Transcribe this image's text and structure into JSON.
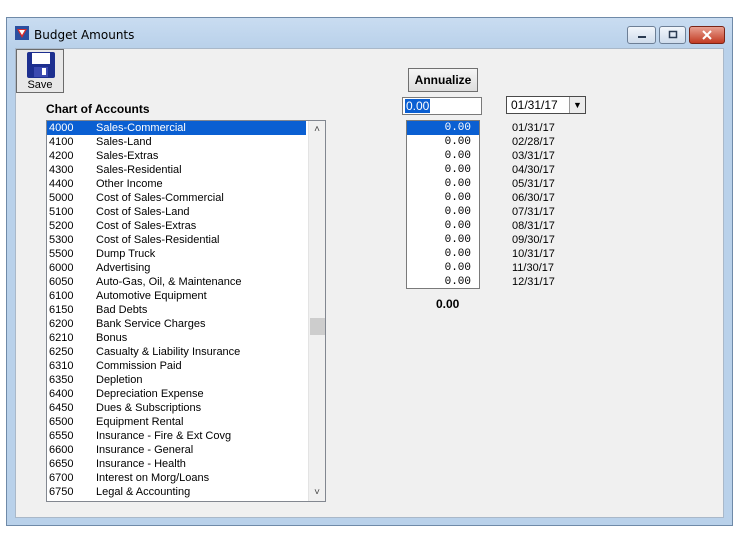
{
  "window": {
    "title": "Budget Amounts",
    "controls": [
      "minimize",
      "maximize",
      "close"
    ]
  },
  "toolbar": {
    "save_label": "Save"
  },
  "chart_of_accounts": {
    "label": "Chart of Accounts",
    "selected_index": 0,
    "items": [
      {
        "code": "4000",
        "name": "Sales-Commercial"
      },
      {
        "code": "4100",
        "name": "Sales-Land"
      },
      {
        "code": "4200",
        "name": "Sales-Extras"
      },
      {
        "code": "4300",
        "name": "Sales-Residential"
      },
      {
        "code": "4400",
        "name": "Other Income"
      },
      {
        "code": "5000",
        "name": "Cost of Sales-Commercial"
      },
      {
        "code": "5100",
        "name": "Cost of Sales-Land"
      },
      {
        "code": "5200",
        "name": "Cost of Sales-Extras"
      },
      {
        "code": "5300",
        "name": "Cost of Sales-Residential"
      },
      {
        "code": "5500",
        "name": "Dump Truck"
      },
      {
        "code": "6000",
        "name": "Advertising"
      },
      {
        "code": "6050",
        "name": "Auto-Gas, Oil, & Maintenance"
      },
      {
        "code": "6100",
        "name": "Automotive Equipment"
      },
      {
        "code": "6150",
        "name": "Bad Debts"
      },
      {
        "code": "6200",
        "name": "Bank Service Charges"
      },
      {
        "code": "6210",
        "name": "Bonus"
      },
      {
        "code": "6250",
        "name": "Casualty & Liability Insurance"
      },
      {
        "code": "6310",
        "name": "Commission Paid"
      },
      {
        "code": "6350",
        "name": "Depletion"
      },
      {
        "code": "6400",
        "name": "Depreciation Expense"
      },
      {
        "code": "6450",
        "name": "Dues & Subscriptions"
      },
      {
        "code": "6500",
        "name": "Equipment Rental"
      },
      {
        "code": "6550",
        "name": "Insurance - Fire & Ext Covg"
      },
      {
        "code": "6600",
        "name": "Insurance - General"
      },
      {
        "code": "6650",
        "name": "Insurance - Health"
      },
      {
        "code": "6700",
        "name": "Interest on Morg/Loans"
      },
      {
        "code": "6750",
        "name": "Legal & Accounting"
      }
    ]
  },
  "annualize": {
    "button_label": "Annualize",
    "amount_value": "0.00",
    "date_selected": "01/31/17"
  },
  "period_amounts": [
    "0.00",
    "0.00",
    "0.00",
    "0.00",
    "0.00",
    "0.00",
    "0.00",
    "0.00",
    "0.00",
    "0.00",
    "0.00",
    "0.00"
  ],
  "period_dates": [
    "01/31/17",
    "02/28/17",
    "03/31/17",
    "04/30/17",
    "05/31/17",
    "06/30/17",
    "07/31/17",
    "08/31/17",
    "09/30/17",
    "10/31/17",
    "11/30/17",
    "12/31/17"
  ],
  "total": "0.00",
  "colors": {
    "selection": "#0a5fd2",
    "window_frame": "#b9d1ea",
    "client_bg": "#f0f0f0"
  }
}
